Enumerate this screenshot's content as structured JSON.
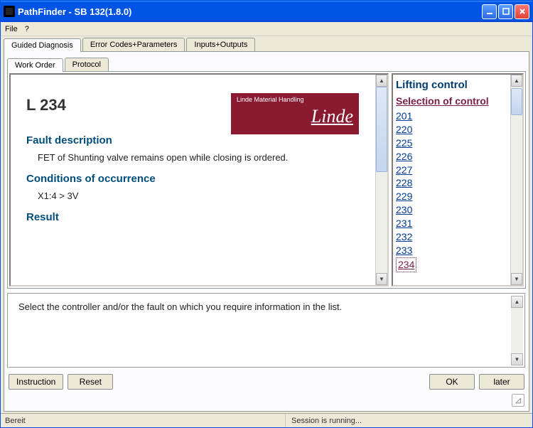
{
  "window": {
    "title": "PathFinder - SB 132(1.8.0)"
  },
  "menubar": {
    "items": [
      {
        "label": "File"
      },
      {
        "label": "?"
      }
    ]
  },
  "mainTabs": [
    {
      "label": "Guided Diagnosis",
      "active": true
    },
    {
      "label": "Error Codes+Parameters",
      "active": false
    },
    {
      "label": "Inputs+Outputs",
      "active": false
    }
  ],
  "subTabs": [
    {
      "label": "Work Order",
      "active": true
    },
    {
      "label": "Protocol",
      "active": false
    }
  ],
  "fault": {
    "code": "L  234",
    "logo_small": "Linde Material Handling",
    "logo_big": "Linde",
    "sections": {
      "fault_desc_h": "Fault description",
      "fault_desc_p": "FET of Shunting valve remains open while closing is ordered.",
      "cond_h": "Conditions of occurrence",
      "cond_p": "X1:4 > 3V",
      "result_h": "Result"
    }
  },
  "sidebar": {
    "heading": "Lifting control",
    "subheading": "Selection of control",
    "links": [
      "201",
      "220",
      "225",
      "226",
      "227",
      "228",
      "229",
      "230",
      "231",
      "232",
      "233",
      "234"
    ],
    "selected": "234"
  },
  "instructionPanel": {
    "text": "Select the controller and/or the fault on which you require information in the list."
  },
  "buttons": {
    "instruction": "Instruction",
    "reset": "Reset",
    "ok": "OK",
    "later": "later"
  },
  "statusbar": {
    "left": "Bereit",
    "right": "Session is running..."
  }
}
